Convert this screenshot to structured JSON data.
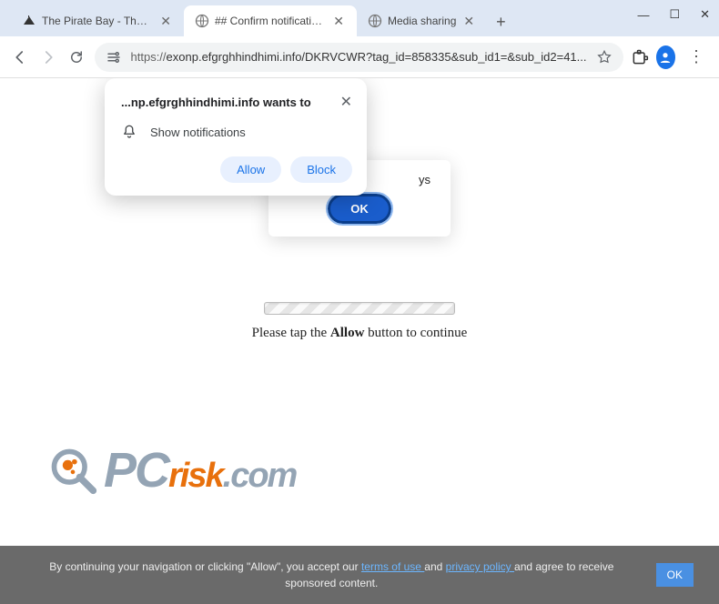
{
  "tabs": [
    {
      "title": "The Pirate Bay - The gala"
    },
    {
      "title": "## Confirm notifications"
    },
    {
      "title": "Media sharing"
    }
  ],
  "window": {
    "minimize": "—",
    "maximize": "☐",
    "close": "✕"
  },
  "toolbar": {
    "new_tab": "+"
  },
  "address": {
    "url_prefix": "https://",
    "url_rest": "exonp.efgrghhindhimi.info/DKRVCWR?tag_id=858335&sub_id1=&sub_id2=41..."
  },
  "menu": "⋮",
  "alert": {
    "msg": "ys",
    "ok": "OK"
  },
  "notif": {
    "title": "...np.efgrghhindhimi.info wants to",
    "body": "Show notifications",
    "allow": "Allow",
    "block": "Block",
    "close": "✕"
  },
  "progress": {
    "pre": "Please tap the ",
    "strong": "Allow",
    "post": " button to continue"
  },
  "watermark": {
    "pc": "PC",
    "risk": "risk",
    "com": ".com"
  },
  "consent": {
    "pre": "By continuing your navigation or clicking \"Allow\", you accept our ",
    "terms": "terms of use ",
    "mid": "and ",
    "privacy": "privacy policy ",
    "post": "and agree to receive sponsored content.",
    "ok": "OK"
  }
}
